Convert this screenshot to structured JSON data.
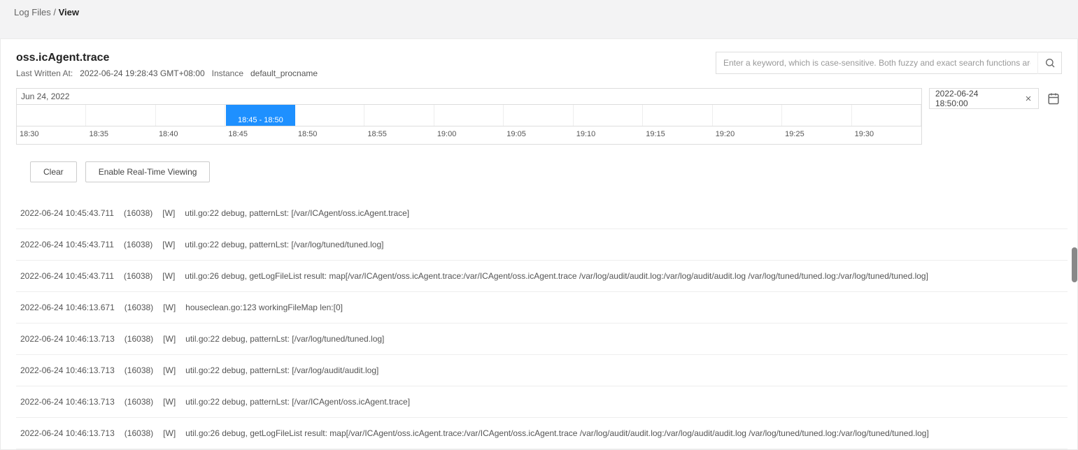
{
  "breadcrumb": {
    "parent": "Log Files",
    "current": "View"
  },
  "title": "oss.icAgent.trace",
  "meta": {
    "last_written_label": "Last Written At:",
    "last_written_value": "2022-06-24 19:28:43 GMT+08:00",
    "instance_label": "Instance",
    "instance_value": "default_procname"
  },
  "search": {
    "placeholder": "Enter a keyword, which is case-sensitive. Both fuzzy and exact search functions are supported."
  },
  "timeline": {
    "date": "Jun 24, 2022",
    "selection_label": "18:45 - 18:50",
    "selection_start_pct": 23.1,
    "selection_width_pct": 7.69,
    "labels": [
      "18:30",
      "18:35",
      "18:40",
      "18:45",
      "18:50",
      "18:55",
      "19:00",
      "19:05",
      "19:10",
      "19:15",
      "19:20",
      "19:25",
      "19:30"
    ]
  },
  "time_display": "2022-06-24 18:50:00",
  "buttons": {
    "clear": "Clear",
    "realtime": "Enable Real-Time Viewing"
  },
  "logs": [
    {
      "ts": "2022-06-24 10:45:43.711",
      "pid": "(16038)",
      "lvl": "[W]",
      "msg": "util.go:22 debug, patternLst: [/var/ICAgent/oss.icAgent.trace]"
    },
    {
      "ts": "2022-06-24 10:45:43.711",
      "pid": "(16038)",
      "lvl": "[W]",
      "msg": "util.go:22 debug, patternLst: [/var/log/tuned/tuned.log]"
    },
    {
      "ts": "2022-06-24 10:45:43.711",
      "pid": "(16038)",
      "lvl": "[W]",
      "msg": "util.go:26 debug, getLogFileList result: map[/var/ICAgent/oss.icAgent.trace:/var/ICAgent/oss.icAgent.trace /var/log/audit/audit.log:/var/log/audit/audit.log /var/log/tuned/tuned.log:/var/log/tuned/tuned.log]"
    },
    {
      "ts": "2022-06-24 10:46:13.671",
      "pid": "(16038)",
      "lvl": "[W]",
      "msg": "houseclean.go:123 workingFileMap len:[0]"
    },
    {
      "ts": "2022-06-24 10:46:13.713",
      "pid": "(16038)",
      "lvl": "[W]",
      "msg": "util.go:22 debug, patternLst: [/var/log/tuned/tuned.log]"
    },
    {
      "ts": "2022-06-24 10:46:13.713",
      "pid": "(16038)",
      "lvl": "[W]",
      "msg": "util.go:22 debug, patternLst: [/var/log/audit/audit.log]"
    },
    {
      "ts": "2022-06-24 10:46:13.713",
      "pid": "(16038)",
      "lvl": "[W]",
      "msg": "util.go:22 debug, patternLst: [/var/ICAgent/oss.icAgent.trace]"
    },
    {
      "ts": "2022-06-24 10:46:13.713",
      "pid": "(16038)",
      "lvl": "[W]",
      "msg": "util.go:26 debug, getLogFileList result: map[/var/ICAgent/oss.icAgent.trace:/var/ICAgent/oss.icAgent.trace /var/log/audit/audit.log:/var/log/audit/audit.log /var/log/tuned/tuned.log:/var/log/tuned/tuned.log]"
    }
  ]
}
